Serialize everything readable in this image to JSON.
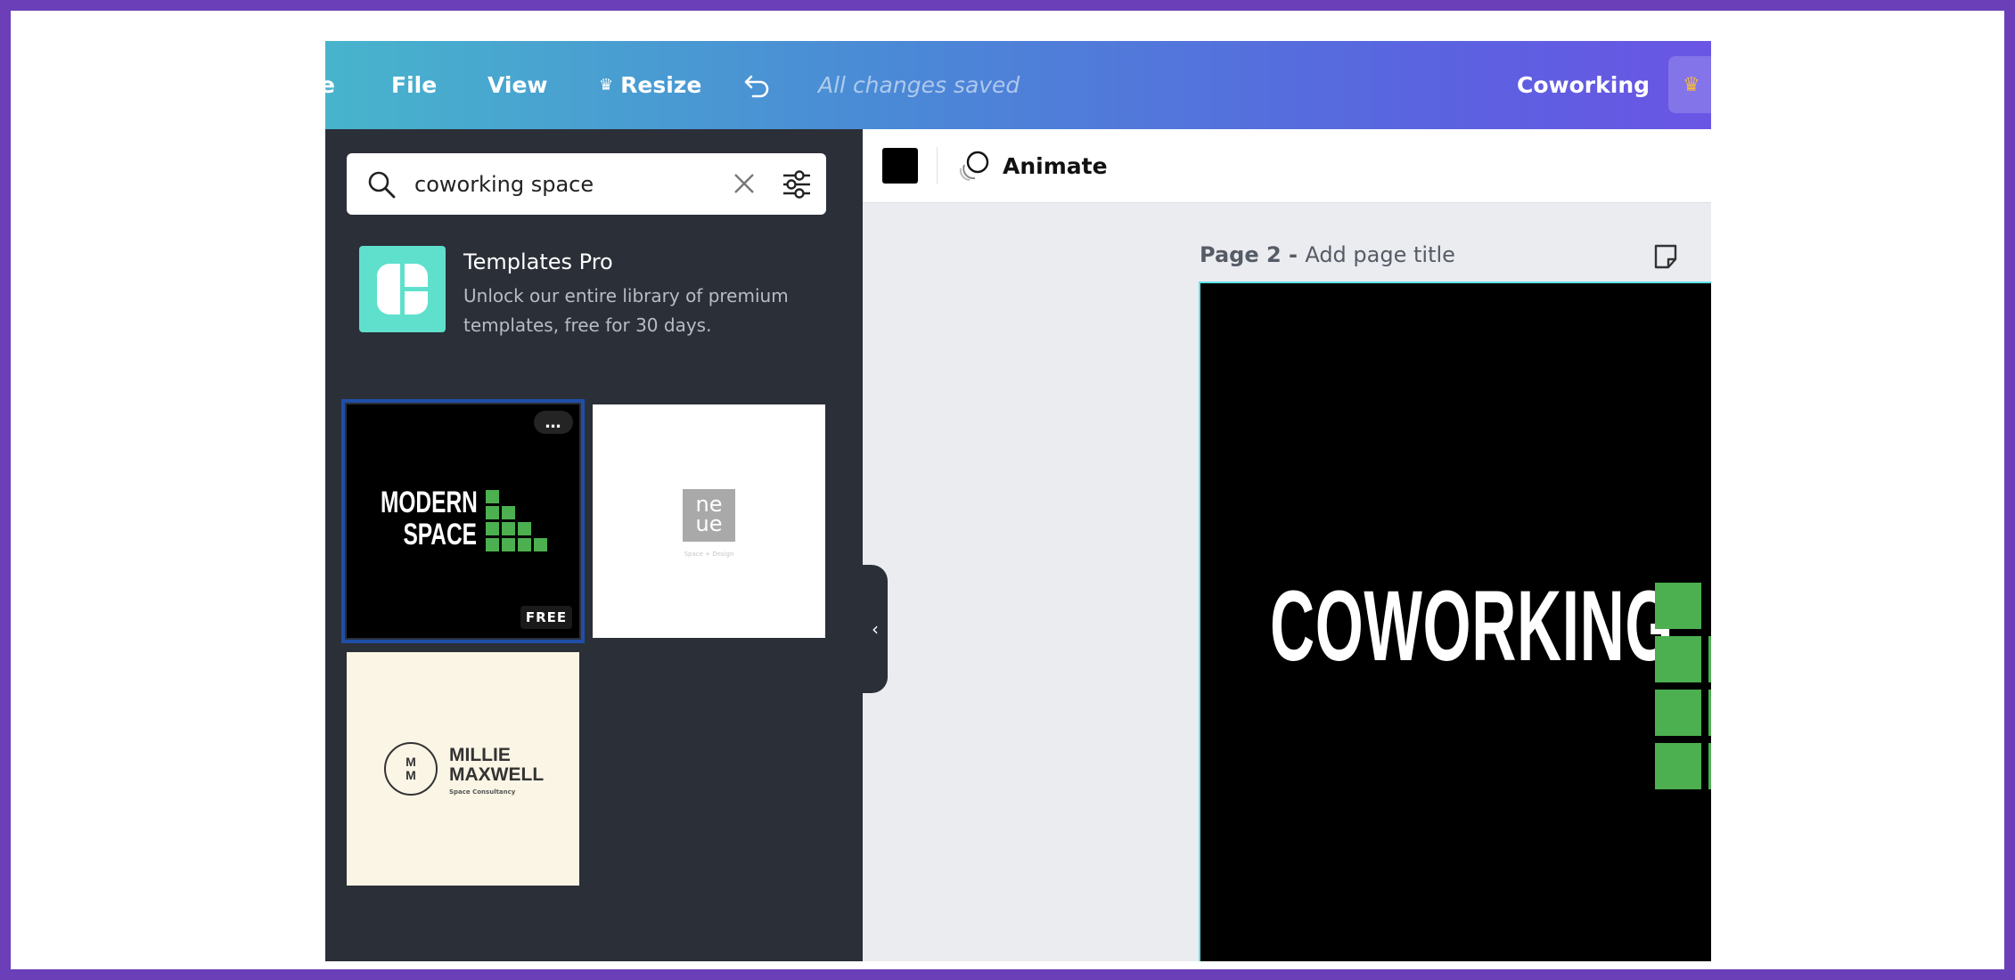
{
  "topbar": {
    "back_glyph": "e",
    "menu": {
      "file": "File",
      "view": "View",
      "resize": "Resize"
    },
    "resize_icon": "crown-icon",
    "undo_icon": "undo-icon",
    "status": "All changes saved",
    "design_title": "Coworking",
    "upgrade_icon": "crown-icon",
    "colors": {
      "gradient_start": "#48b4cc",
      "gradient_end": "#6a55e4",
      "crown": "#f6b93b"
    }
  },
  "panel": {
    "search": {
      "value": "coworking space",
      "search_icon": "search-icon",
      "clear_icon": "close-icon",
      "filter_icon": "filter-sliders-icon"
    },
    "promo": {
      "title": "Templates Pro",
      "text": "Unlock our entire library of premium templates, free for 30 days.",
      "logo_color": "#5ee0cc"
    },
    "templates": [
      {
        "text_line1": "MODERN",
        "text_line2": "SPACE",
        "badge": "FREE",
        "more": "…",
        "selected": true
      },
      {
        "logo_line1": "ne",
        "logo_line2": "ue",
        "tagline": "Space + Design"
      },
      {
        "monogram_1": "M",
        "monogram_2": "M",
        "name_line1": "MILLIE",
        "name_line2": "MAXWELL",
        "tagline": "Space Consultancy"
      }
    ],
    "background": "#2b2f38"
  },
  "toolbar": {
    "color_swatch": "#000000",
    "animate_icon": "animate-circles-icon",
    "animate_label": "Animate"
  },
  "canvas": {
    "page_label": "Page 2 - ",
    "page_title_placeholder": "Add page title",
    "note_icon": "sticky-note-icon",
    "design_text": "COWORKING",
    "accent_green": "#4caf50",
    "border_color": "#5ce1e6"
  }
}
